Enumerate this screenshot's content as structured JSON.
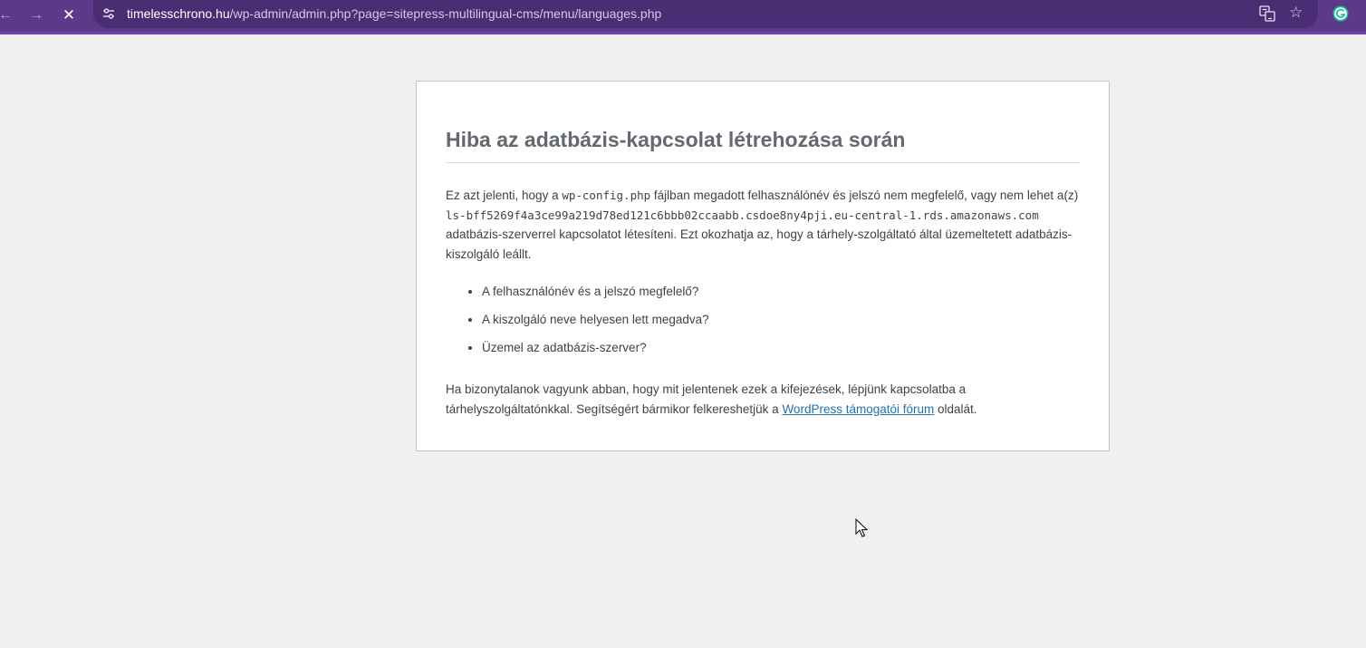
{
  "browser": {
    "url_host": "timelesschrono.hu",
    "url_path": "/wp-admin/admin.php?page=sitepress-multilingual-cms/menu/languages.php",
    "icons": {
      "back": "arrow-left-icon",
      "forward": "arrow-right-icon",
      "stop": "close-icon",
      "site_info": "tune-icon",
      "translate": "translate-icon",
      "bookmark": "star-icon",
      "extension": "grammarly-icon"
    },
    "colors": {
      "toolbar": "#5c3a8a",
      "omnibox": "#4b2d73",
      "accent_border": "#6a3fb0"
    }
  },
  "error": {
    "title": "Hiba az adatbázis-kapcsolat létrehozása során",
    "p1_a": "Ez azt jelenti, hogy a ",
    "p1_config": "wp-config.php",
    "p1_b": " fájlban megadott felhasználónév és jelszó nem megfelelő, vagy nem lehet a(z) ",
    "p1_host": "ls-bff5269f4a3ce99a219d78ed121c6bbb02ccaabb.csdoe8ny4pji.eu-central-1.rds.amazonaws.com",
    "p1_c": " adatbázis-szerverrel kapcsolatot létesíteni. Ezt okozhatja az, hogy a tárhely-szolgáltató által üzemeltetett adatbázis-kiszolgáló leállt.",
    "reasons": [
      "A felhasználónév és a jelszó megfelelő?",
      "A kiszolgáló neve helyesen lett megadva?",
      "Üzemel az adatbázis-szerver?"
    ],
    "p2_a": "Ha bizonytalanok vagyunk abban, hogy mit jelentenek ezek a kifejezések, lépjünk kapcsolatba a tárhelyszolgáltatónkkal. Segítségért bármikor felkereshetjük a ",
    "p2_link": "WordPress támogatói fórum",
    "p2_b": " oldalát.",
    "colors": {
      "link": "#2271b1",
      "title": "#646970",
      "text": "#3c434a",
      "page_bg": "#f0f0f1"
    }
  }
}
